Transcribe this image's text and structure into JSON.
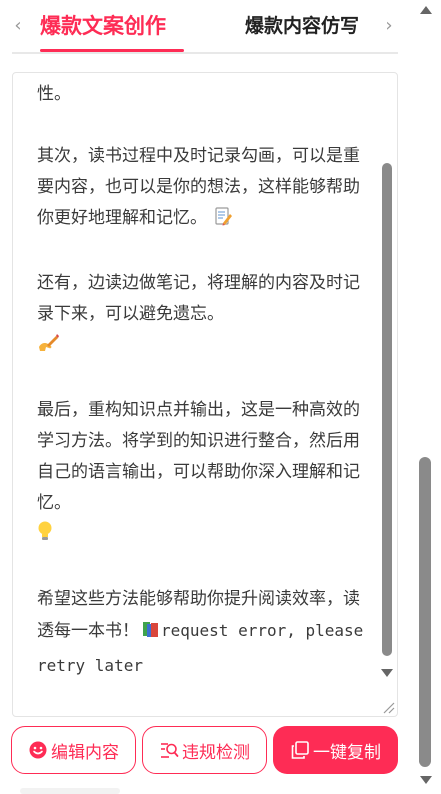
{
  "tabs": {
    "prev_arrow": "‹",
    "next_arrow": "›",
    "active_label": "爆款文案创作",
    "inactive_label": "爆款内容仿写"
  },
  "content": {
    "paragraphs": [
      {
        "text": "性。",
        "emoji": ""
      },
      {
        "text": "其次，读书过程中及时记录勾画，可以是重要内容，也可以是你的想法，这样能够帮助你更好地理解和记忆。",
        "emoji": "memo-icon"
      },
      {
        "text": "还有，边读边做笔记，将理解的内容及时记录下来，可以避免遗忘。",
        "emoji": "writing-hand-icon"
      },
      {
        "text": "最后，重构知识点并输出，这是一种高效的学习方法。将学到的知识进行整合，然后用自己的语言输出，可以帮助你深入理解和记忆。",
        "emoji": "light-bulb-icon"
      },
      {
        "text": "希望这些方法能够帮助你提升阅读效率，读透每一本书！",
        "emoji": "books-icon"
      }
    ],
    "tail": "request error, please retry later"
  },
  "buttons": {
    "edit_label": "编辑内容",
    "check_label": "违规检测",
    "copy_label": "一键复制"
  },
  "colors": {
    "accent": "#fe2c55",
    "text": "#3a3a3a",
    "scrollbar": "#8a8a8a"
  }
}
